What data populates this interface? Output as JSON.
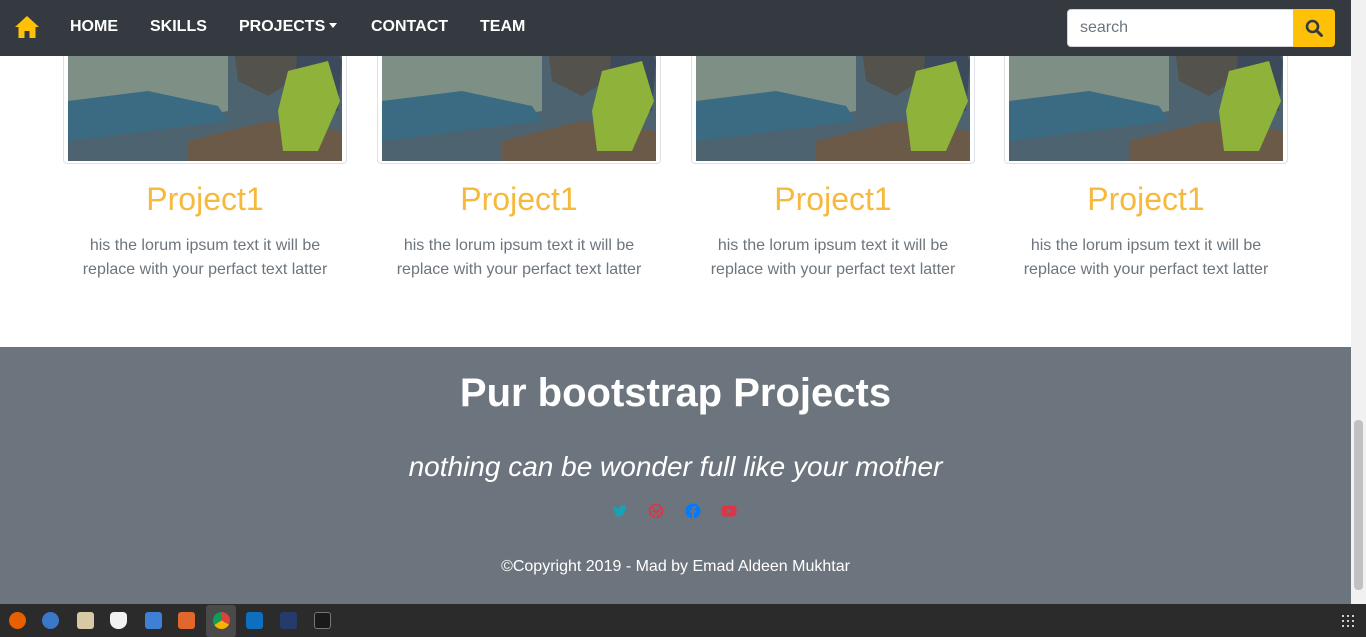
{
  "navbar": {
    "home_icon": "home-icon",
    "links": [
      "HOME",
      "SKILLS",
      "PROJECTS",
      "CONTACT",
      "TEAM"
    ],
    "search_placeholder": "search",
    "search_icon": "search-icon",
    "accent_color": "#ffc107",
    "background_color": "#343a40"
  },
  "projects": [
    {
      "title": "Project1",
      "text": "his the lorum ipsum text it will be replace with your perfact text latter"
    },
    {
      "title": "Project1",
      "text": "his the lorum ipsum text it will be replace with your perfact text latter"
    },
    {
      "title": "Project1",
      "text": "his the lorum ipsum text it will be replace with your perfact text latter"
    },
    {
      "title": "Project1",
      "text": "his the lorum ipsum text it will be replace with your perfact text latter"
    }
  ],
  "footer": {
    "title": "Pur bootstrap Projects",
    "quote": "nothing can be wonder full like your mother",
    "social_icons": [
      "twitter-icon",
      "dribbble-icon",
      "facebook-icon",
      "youtube-icon"
    ],
    "copyright": "©Copyright 2019 - Mad by Emad Aldeen Mukhtar",
    "background_color": "#6c757d"
  },
  "taskbar": {
    "apps": [
      "firefox-icon",
      "thunderbird-icon",
      "files-icon",
      "libreoffice-icon",
      "writer-icon",
      "software-center-icon",
      "chrome-icon",
      "vscode-icon",
      "network-icon",
      "terminal-icon"
    ],
    "active_app": "chrome-icon"
  }
}
